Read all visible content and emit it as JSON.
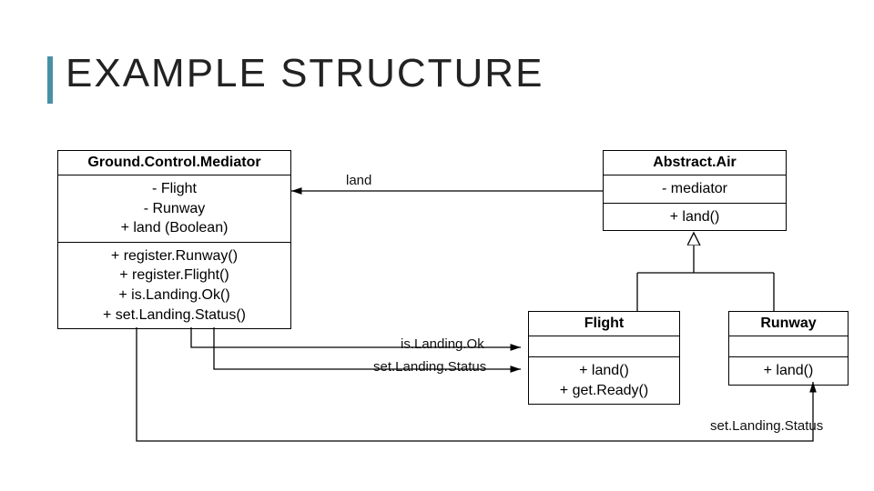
{
  "title": "EXAMPLE STRUCTURE",
  "classes": {
    "gcm": {
      "name": "Ground.Control.Mediator",
      "attrs": "- Flight\n- Runway\n+ land (Boolean)",
      "ops": "+ register.Runway()\n+ register.Flight()\n+ is.Landing.Ok()\n+ set.Landing.Status()"
    },
    "abstractAir": {
      "name": "Abstract.Air",
      "attrs": "- mediator",
      "ops": "+ land()"
    },
    "flight": {
      "name": "Flight",
      "attrs": "",
      "ops": "+ land()\n+ get.Ready()"
    },
    "runway": {
      "name": "Runway",
      "attrs": "",
      "ops": "+ land()"
    }
  },
  "labels": {
    "land": "land",
    "isLandingOk": "is.Landing.Ok",
    "setLandingStatusLeft": "set.Landing.Status",
    "setLandingStatusRight": "set.Landing.Status"
  }
}
